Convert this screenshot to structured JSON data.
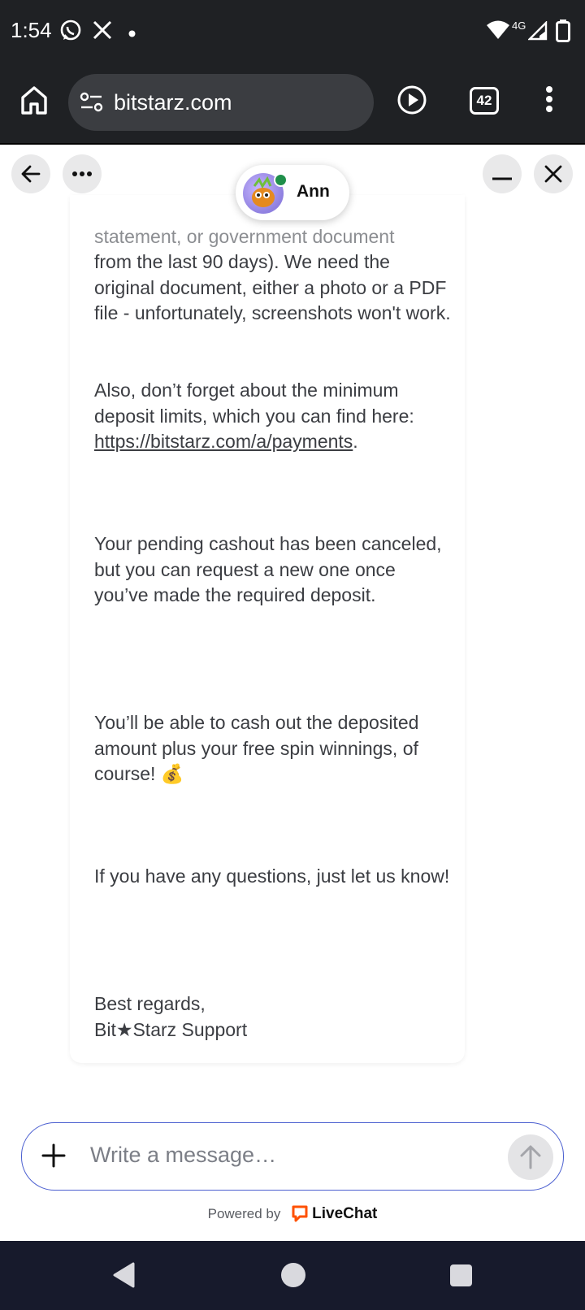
{
  "status_bar": {
    "time": "1:54",
    "network": "4G",
    "icons": [
      "whatsapp-icon",
      "x-icon",
      "notification-dot-icon",
      "wifi-icon",
      "signal-icon",
      "battery-icon"
    ]
  },
  "browser": {
    "url": "bitstarz.com",
    "tab_count": "42",
    "icons": [
      "home-icon",
      "site-settings-icon",
      "play-icon",
      "tabs-icon",
      "overflow-menu-icon"
    ]
  },
  "chat_header": {
    "agent_name": "Ann",
    "agent_status": "online",
    "buttons": [
      "back-button",
      "more-options-button",
      "minimize-button",
      "close-button"
    ]
  },
  "message": {
    "paragraphs": [
      "statement, or government document",
      "from the last 90 days). We need the original document, either a photo or a PDF file - unfortunately, screenshots won't work.",
      "Also, don’t forget about the minimum deposit limits, which you can find here: ",
      "https://bitstarz.com/a/payments",
      ".",
      "Your pending cashout has been canceled, but you can request a new one once you’ve made the required deposit.",
      "You’ll be able to cash out the deposited amount plus your free spin winnings, of course! 💰",
      "If you have any questions, just let us know!",
      "Best regards,",
      "Bit★Starz Support"
    ]
  },
  "composer": {
    "placeholder": "Write a message…"
  },
  "footer": {
    "powered_by": "Powered by",
    "brand": "LiveChat",
    "brand_color": "#ff5100"
  },
  "colors": {
    "chrome_bg": "#1f2124",
    "nav_bg": "#171a2c",
    "composer_border": "#4b5fd0",
    "online": "#1f8f4a"
  }
}
